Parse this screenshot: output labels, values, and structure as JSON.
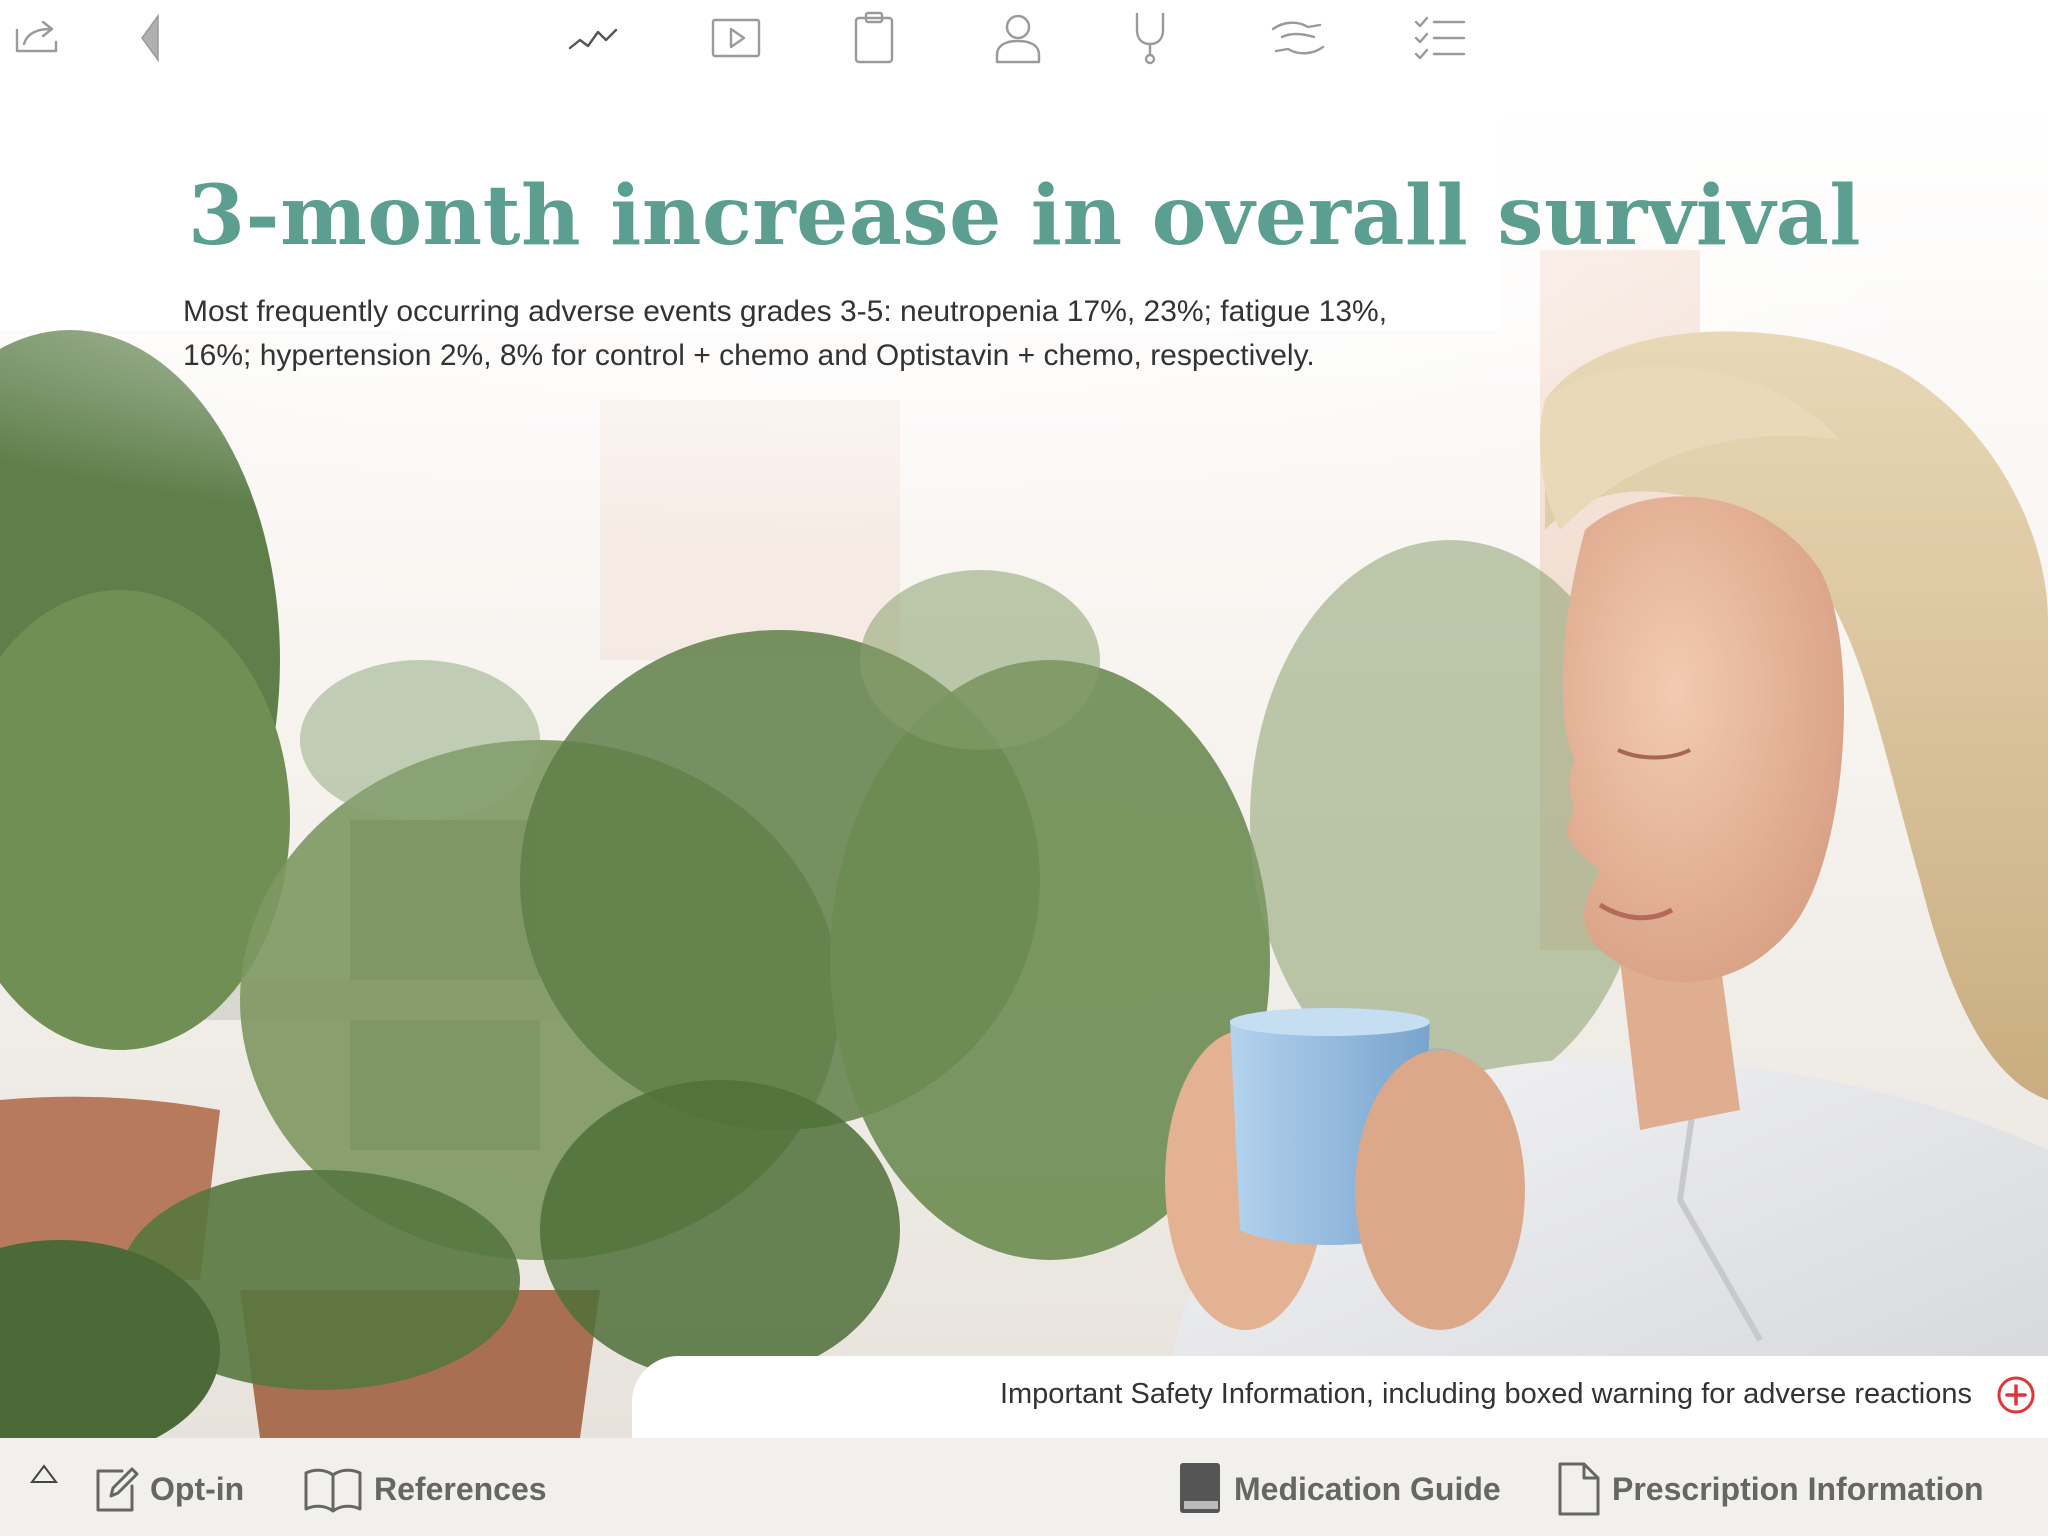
{
  "top_nav": {
    "icons": [
      "share-icon",
      "back-icon",
      "trend-icon",
      "video-icon",
      "clipboard-icon",
      "patient-icon",
      "stethoscope-icon",
      "hands-icon",
      "checklist-icon"
    ]
  },
  "hero": {
    "title": "3-month increase in overall survival",
    "subtitle_line1": "Most frequently occurring adverse events grades 3-5: neutropenia 17%, 23%; fatigue 13%,",
    "subtitle_line2": "16%; hypertension 2%, 8% for control + chemo and Optistavin + chemo, respectively."
  },
  "safety": {
    "text": "Important Safety Information, including boxed warning for adverse reactions"
  },
  "bottom_bar": {
    "opt_in": "Opt-in",
    "references": "References",
    "medication_guide": "Medication Guide",
    "prescription_information": "Prescription Information"
  },
  "colors": {
    "title": "#5c9f90",
    "accent_red": "#e2353a",
    "bottom_bar_bg": "#f1f0ec"
  }
}
